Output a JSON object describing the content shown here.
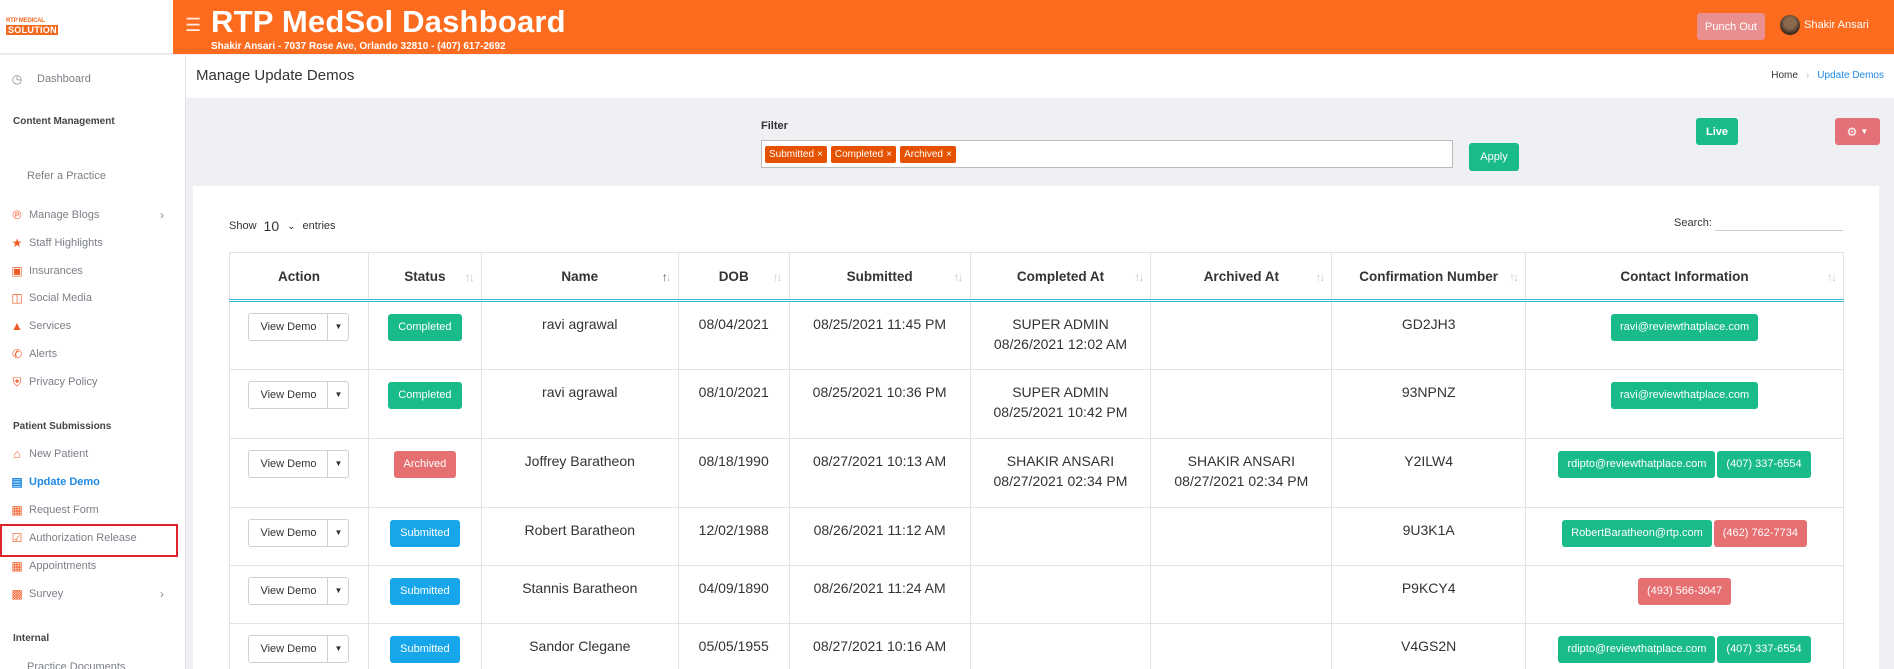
{
  "header": {
    "logo_line1": "RTP MEDICAL",
    "logo_line2": "SOLUTION",
    "title": "RTP MedSol Dashboard",
    "subtitle": "Shakir Ansari - 7037 Rose Ave, Orlando 32810 - (407) 617-2692",
    "punch_out": "Punch Out",
    "user_name": "Shakir Ansari",
    "color": "#fd6b1f"
  },
  "sidebar": {
    "dashboard": "Dashboard",
    "content_heading": "Content Management",
    "refer": "Refer a Practice",
    "items_content": [
      {
        "label": "Manage Blogs",
        "icon": "blog-icon"
      },
      {
        "label": "Staff Highlights",
        "icon": "staff-icon"
      },
      {
        "label": "Insurances",
        "icon": "insurance-icon"
      },
      {
        "label": "Social Media",
        "icon": "social-icon"
      },
      {
        "label": "Services",
        "icon": "services-icon"
      },
      {
        "label": "Alerts",
        "icon": "alert-icon"
      },
      {
        "label": "Privacy Policy",
        "icon": "shield-icon"
      }
    ],
    "patient_heading": "Patient Submissions",
    "items_patient": [
      {
        "label": "New Patient",
        "icon": "home-icon"
      },
      {
        "label": "Update Demo",
        "icon": "id-card-icon"
      },
      {
        "label": "Request Form",
        "icon": "form-icon"
      },
      {
        "label": "Authorization Release",
        "icon": "check-icon"
      },
      {
        "label": "Appointments",
        "icon": "calendar-icon"
      },
      {
        "label": "Survey",
        "icon": "survey-icon"
      }
    ],
    "internal_heading": "Internal",
    "practice_docs": "Practice Documents"
  },
  "page": {
    "title": "Manage Update Demos",
    "breadcrumb_home": "Home",
    "breadcrumb_current": "Update Demos"
  },
  "filter": {
    "label": "Filter",
    "tags": [
      "Submitted",
      "Completed",
      "Archived"
    ],
    "apply": "Apply",
    "live": "Live"
  },
  "table_controls": {
    "show": "Show",
    "entries_value": "10",
    "entries": "entries",
    "search_label": "Search:"
  },
  "table": {
    "columns": [
      "Action",
      "Status",
      "Name",
      "DOB",
      "Submitted",
      "Completed At",
      "Archived At",
      "Confirmation Number",
      "Contact Information"
    ],
    "action_label": "View Demo",
    "rows": [
      {
        "status": "Completed",
        "name": "ravi agrawal",
        "dob": "08/04/2021",
        "submitted": "08/25/2021 11:45 PM",
        "completed_by": "SUPER ADMIN",
        "completed_at": "08/26/2021 12:02 AM",
        "archived_by": "",
        "archived_at": "",
        "conf": "GD2JH3",
        "email": "ravi@reviewthatplace.com",
        "phone": ""
      },
      {
        "status": "Completed",
        "name": "ravi agrawal",
        "dob": "08/10/2021",
        "submitted": "08/25/2021 10:36 PM",
        "completed_by": "SUPER ADMIN",
        "completed_at": "08/25/2021 10:42 PM",
        "archived_by": "",
        "archived_at": "",
        "conf": "93NPNZ",
        "email": "ravi@reviewthatplace.com",
        "phone": ""
      },
      {
        "status": "Archived",
        "name": "Joffrey Baratheon",
        "dob": "08/18/1990",
        "submitted": "08/27/2021 10:13 AM",
        "completed_by": "SHAKIR ANSARI",
        "completed_at": "08/27/2021 02:34 PM",
        "archived_by": "SHAKIR ANSARI",
        "archived_at": "08/27/2021 02:34 PM",
        "conf": "Y2ILW4",
        "email": "rdipto@reviewthatplace.com",
        "phone": "(407) 337-6554"
      },
      {
        "status": "Submitted",
        "name": "Robert Baratheon",
        "dob": "12/02/1988",
        "submitted": "08/26/2021 11:12 AM",
        "completed_by": "",
        "completed_at": "",
        "archived_by": "",
        "archived_at": "",
        "conf": "9U3K1A",
        "email": "RobertBaratheon@rtp.com",
        "phone": "(462) 762-7734"
      },
      {
        "status": "Submitted",
        "name": "Stannis Baratheon",
        "dob": "04/09/1890",
        "submitted": "08/26/2021 11:24 AM",
        "completed_by": "",
        "completed_at": "",
        "archived_by": "",
        "archived_at": "",
        "conf": "P9KCY4",
        "email": "",
        "phone": "(493) 566-3047"
      },
      {
        "status": "Submitted",
        "name": "Sandor Clegane",
        "dob": "05/05/1955",
        "submitted": "08/27/2021 10:16 AM",
        "completed_by": "",
        "completed_at": "",
        "archived_by": "",
        "archived_at": "",
        "conf": "V4GS2N",
        "email": "rdipto@reviewthatplace.com",
        "phone": "(407) 337-6554"
      }
    ]
  }
}
